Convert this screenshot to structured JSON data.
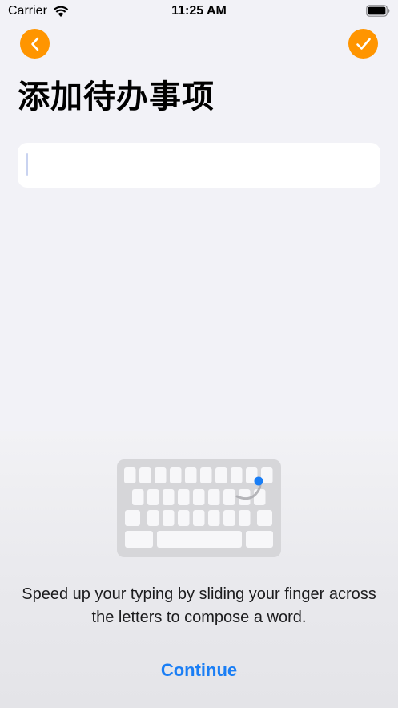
{
  "status_bar": {
    "carrier": "Carrier",
    "time": "11:25 AM"
  },
  "nav": {
    "back_icon": "chevron-left-icon",
    "done_icon": "checkmark-icon"
  },
  "page": {
    "title": "添加待办事项"
  },
  "todo_input": {
    "value": "",
    "placeholder": ""
  },
  "onboarding": {
    "illustration_icon": "swipe-keyboard-icon",
    "message": "Speed up your typing by sliding your finger across the letters to compose a word.",
    "continue_label": "Continue"
  },
  "colors": {
    "accent": "#ff9500",
    "link": "#1a7ef5",
    "background": "#f2f2f7",
    "swipe_dot": "#1a7ef5"
  }
}
